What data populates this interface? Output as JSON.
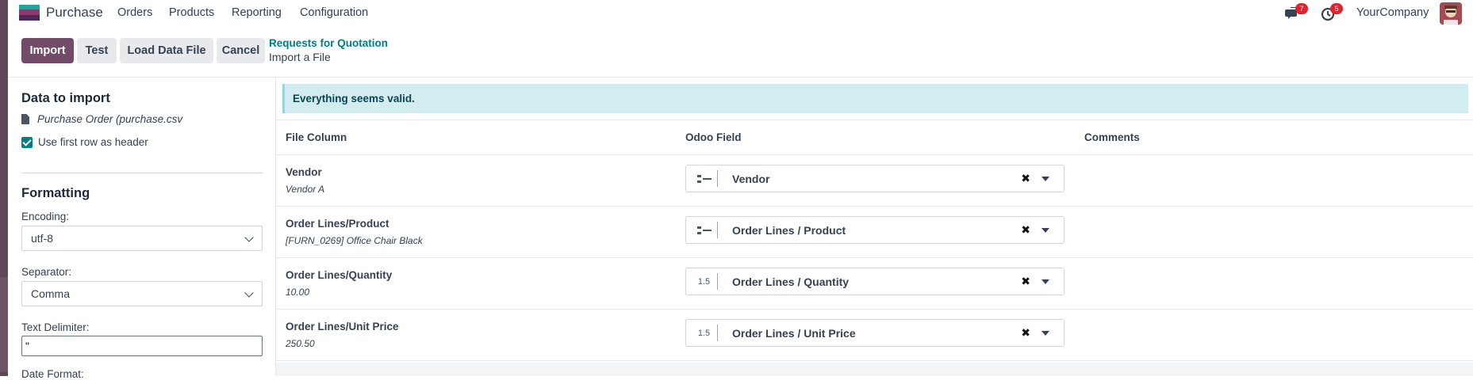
{
  "navbar": {
    "app_name": "Purchase",
    "menu": [
      "Orders",
      "Products",
      "Reporting",
      "Configuration"
    ],
    "chat_badge": "7",
    "activity_badge": "5",
    "company": "YourCompany"
  },
  "control": {
    "buttons": [
      "Import",
      "Test",
      "Load Data File",
      "Cancel"
    ],
    "breadcrumb_parent": "Requests for Quotation",
    "breadcrumb_current": "Import a File"
  },
  "sidebar": {
    "data_title": "Data to import",
    "file_name": "Purchase Order (purchase.csv",
    "header_option": "Use first row as header",
    "formatting_title": "Formatting",
    "encoding_label": "Encoding:",
    "encoding_value": "utf-8",
    "separator_label": "Separator:",
    "separator_value": "Comma",
    "delimiter_label": "Text Delimiter:",
    "delimiter_value": "\"",
    "cutoff_label": "Date Format:"
  },
  "main": {
    "alert": "Everything seems valid.",
    "headers": [
      "File Column",
      "Odoo Field",
      "Comments"
    ],
    "rows": [
      {
        "column": "Vendor",
        "sample": "Vendor A",
        "type": "relation",
        "field": "Vendor"
      },
      {
        "column": "Order Lines/Product",
        "sample": "[FURN_0269] Office Chair Black",
        "type": "relation",
        "field": "Order Lines / Product"
      },
      {
        "column": "Order Lines/Quantity",
        "sample": "10.00",
        "type": "1.5",
        "field": "Order Lines / Quantity"
      },
      {
        "column": "Order Lines/Unit Price",
        "sample": "250.50",
        "type": "1.5",
        "field": "Order Lines / Unit Price"
      }
    ]
  },
  "colors": {
    "brand": "#714b67",
    "accent": "#017e84",
    "alert_bg": "#d2ecf0"
  }
}
